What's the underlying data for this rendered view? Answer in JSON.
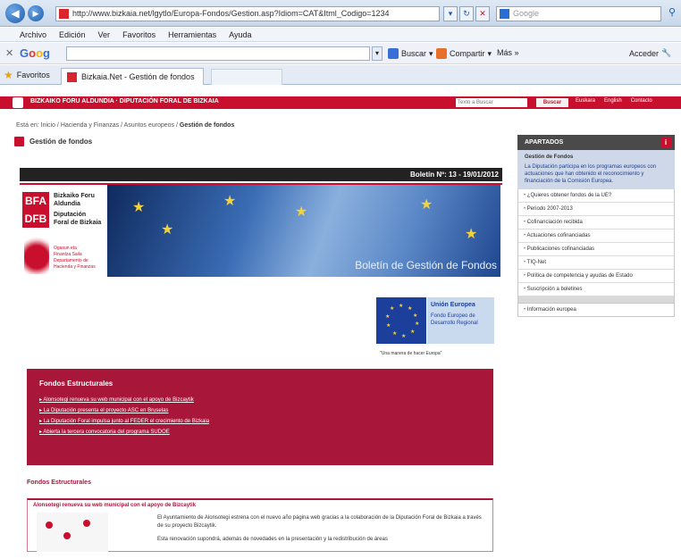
{
  "browser": {
    "address": "http://www.bizkaia.net/lgytlo/Europa-Fondos/Gestion.asp?Idiom=CAT&Itml_Codigo=1234",
    "search_placeholder": "Google",
    "menu": [
      "Archivo",
      "Edición",
      "Ver",
      "Favoritos",
      "Herramientas",
      "Ayuda"
    ],
    "google_label": "Google",
    "toolbar": {
      "buscar": "Buscar",
      "compartir": "Compartir",
      "mas": "Más »",
      "acceder": "Acceder"
    },
    "favorites_label": "Favoritos",
    "tab_title": "Bizkaia.Net - Gestión de fondos"
  },
  "site": {
    "redbar_text": "BIZKAIKO FORU ALDUNDIA · DIPUTACIÓN FORAL DE BIZKAIA",
    "search_placeholder": "Texto a Buscar",
    "search_button": "Buscar",
    "links": [
      "Euskara",
      "English",
      "Contacto"
    ],
    "breadcrumb": {
      "prefix": "Está en:",
      "trail": "Inicio / Hacienda y Finanzas / Asuntos europeos /",
      "current": "Gestión de fondos"
    },
    "page_title": "Gestión de fondos"
  },
  "bulletin": {
    "label": "Boletín Nº: 13 - 19/01/2012",
    "logo": {
      "top": "BFA",
      "bottom": "DFB"
    },
    "logo_lines": [
      "Bizkaiko Foru",
      "Aldundia",
      "Diputación",
      "Foral de Bizkaia"
    ],
    "logo_sub": [
      "Ogasun eta",
      "Finantza Saila",
      "Departamento de",
      "Hacienda y Finanzas"
    ],
    "banner_caption": "Boletín de Gestión de Fondos"
  },
  "eu": {
    "title": "Unión Europea",
    "fund": "Fondo Europeo de Desarrollo Regional",
    "caption": "\"Una manera de hacer Europa\""
  },
  "fondos": {
    "title": "Fondos Estructurales",
    "items": [
      "Alonsotegi renueva su web municipal con el apoyo de Bizcaytik",
      "La Diputación presenta el proyecto ASC en Bruselas",
      "La Diputación Foral impulsa junto al FEDER el crecimiento de Bizkaia",
      "Abierta la tercera convocatoria del programa SUDOE"
    ]
  },
  "section_title": "Fondos Estructurales",
  "article": {
    "title": "Alonsotegi renueva su web municipal con el apoyo de Bizcaytik",
    "text1": "El Ayuntamiento de Alonsotegi estrena con el nuevo año página web gracias a la colaboración de la Diputación Foral de Bizkaia a través de su proyecto Bizcaytik.",
    "text2": "Esta renovación supondrá, además de novedades en la presentación y la redistribución de áreas"
  },
  "sidebar": {
    "header": "APARTADOS",
    "intro_title": "Gestión de Fondos",
    "intro_text": "La Diputación participa en los programas europeos con actuaciones que han obtenido el reconocimiento y financiación de la Comisión Europea.",
    "items": [
      "¿Quieres obtener fondos de la UE?",
      "Periodo 2007-2013",
      "Cofinanciación recibida",
      "Actuaciones cofinanciadas",
      "Publicaciones cofinanciadas",
      "TIQ-Net",
      "Política de competencia y ayudas de Estado",
      "Suscripción a boletines"
    ],
    "extra_item": "Información europea"
  }
}
